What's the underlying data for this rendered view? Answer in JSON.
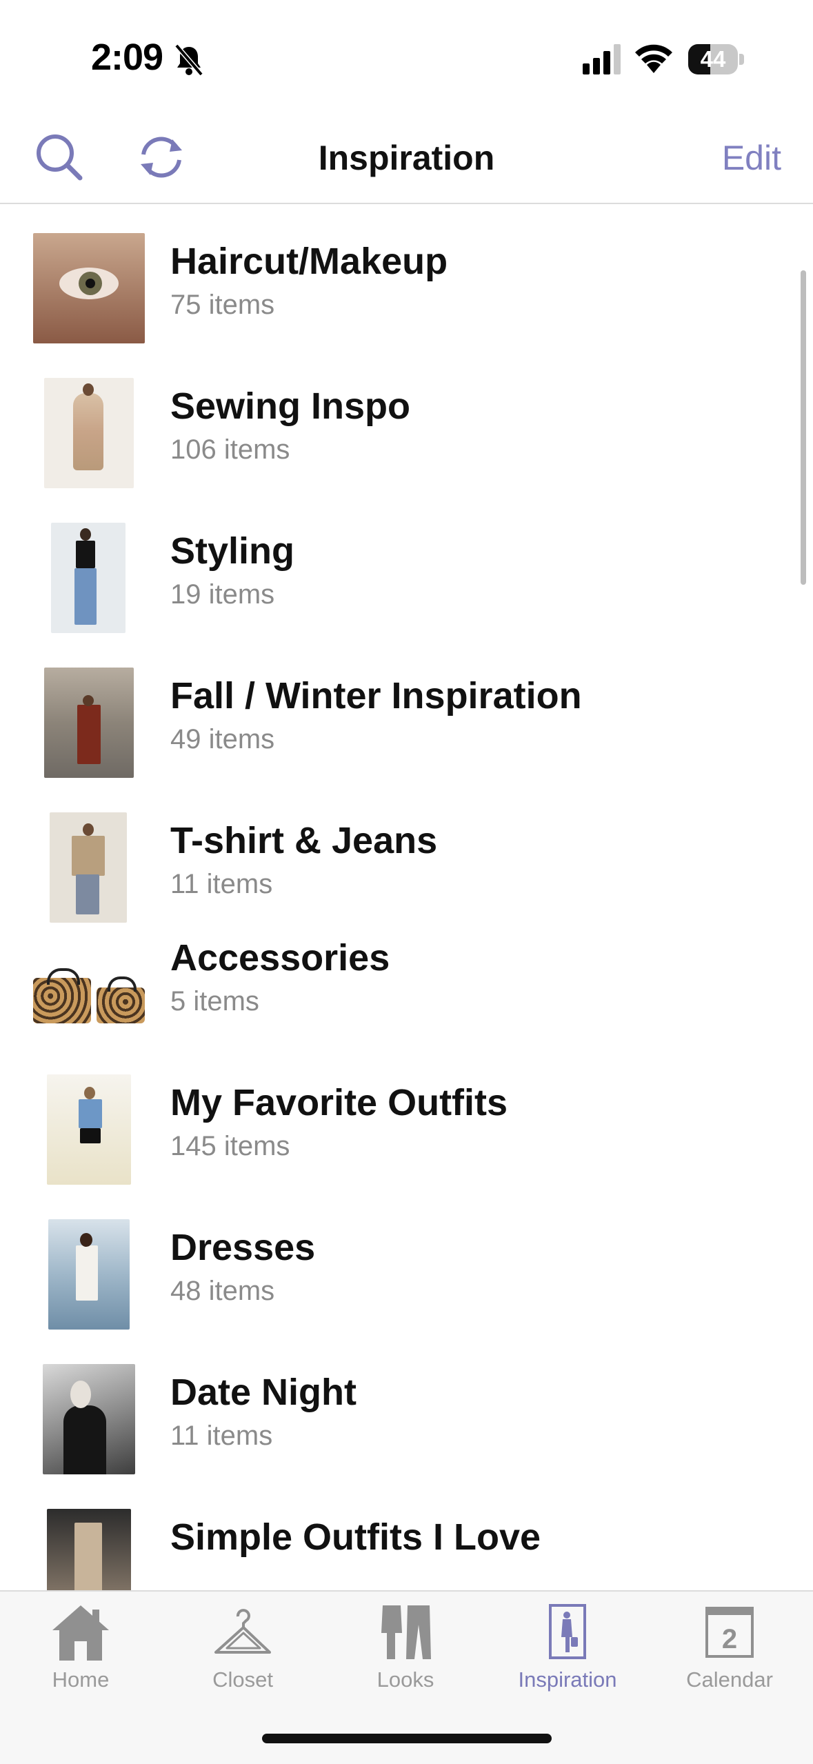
{
  "status_bar": {
    "time": "2:09",
    "battery": "44"
  },
  "nav": {
    "title": "Inspiration",
    "edit_label": "Edit",
    "search_icon": "search-icon",
    "refresh_icon": "refresh-icon"
  },
  "colors": {
    "accent": "#8080c0",
    "muted": "#8a8a8a"
  },
  "boards": [
    {
      "title": "Haircut/Makeup",
      "count": "75 items"
    },
    {
      "title": "Sewing Inspo",
      "count": "106 items"
    },
    {
      "title": "Styling",
      "count": "19 items"
    },
    {
      "title": "Fall / Winter Inspiration",
      "count": "49 items"
    },
    {
      "title": "T-shirt & Jeans",
      "count": "11 items"
    },
    {
      "title": "Accessories",
      "count": "5 items"
    },
    {
      "title": "My Favorite Outfits",
      "count": "145 items"
    },
    {
      "title": "Dresses",
      "count": "48 items"
    },
    {
      "title": "Date Night",
      "count": "11 items"
    },
    {
      "title": "Simple Outfits I Love",
      "count": ""
    }
  ],
  "tabs": [
    {
      "label": "Home",
      "icon": "home-icon",
      "active": false
    },
    {
      "label": "Closet",
      "icon": "hanger-icon",
      "active": false
    },
    {
      "label": "Looks",
      "icon": "looks-icon",
      "active": false
    },
    {
      "label": "Inspiration",
      "icon": "inspiration-icon",
      "active": true
    },
    {
      "label": "Calendar",
      "icon": "calendar-icon",
      "active": false,
      "badge": "2"
    }
  ]
}
